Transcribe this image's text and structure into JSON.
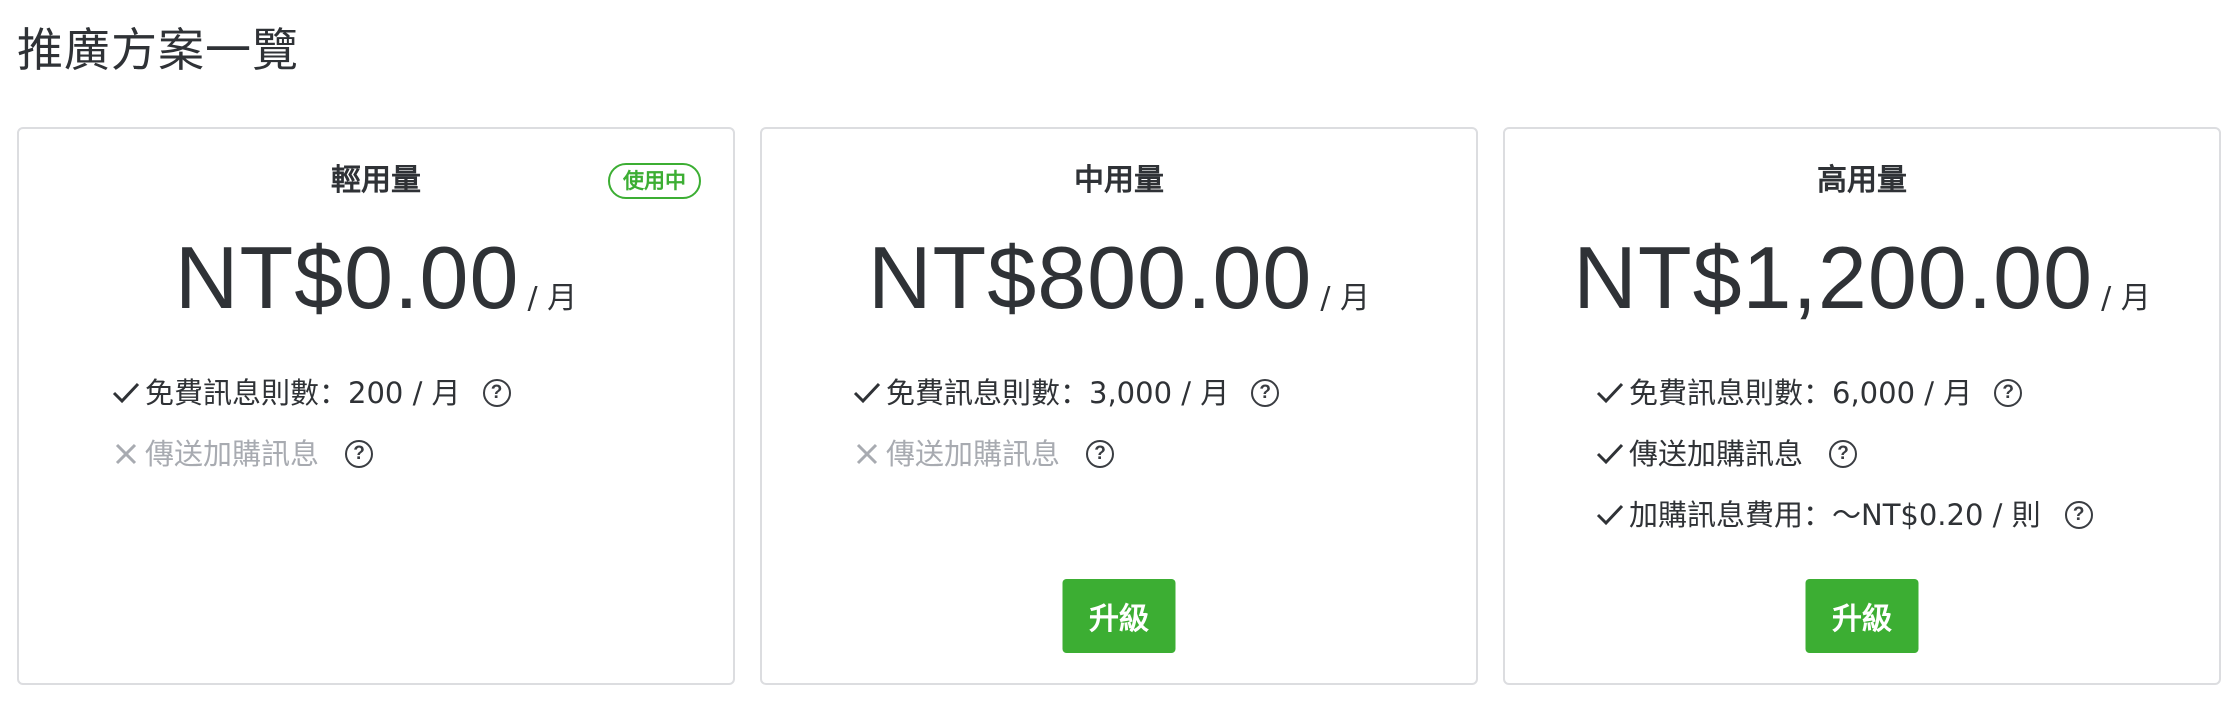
{
  "page": {
    "title": "推廣方案一覽"
  },
  "colors": {
    "accent_green": "#3cae33",
    "text_dark": "#2f3236",
    "text_disabled": "#a8abb1",
    "card_border": "#dcdde0"
  },
  "plans": [
    {
      "name": "輕用量",
      "badge": "使用中",
      "price": "NT$0.00",
      "period": "/ 月",
      "features": [
        {
          "icon": "check-icon",
          "enabled": true,
          "label": "免費訊息則數：200 / 月",
          "help_icon": "question-circle-icon",
          "help_glyph": "?"
        },
        {
          "icon": "cross-icon",
          "enabled": false,
          "label": "傳送加購訊息",
          "help_icon": "question-circle-icon",
          "help_glyph": "?"
        }
      ]
    },
    {
      "name": "中用量",
      "price": "NT$800.00",
      "period": "/ 月",
      "features": [
        {
          "icon": "check-icon",
          "enabled": true,
          "label": "免費訊息則數：3,000 / 月",
          "help_icon": "question-circle-icon",
          "help_glyph": "?"
        },
        {
          "icon": "cross-icon",
          "enabled": false,
          "label": "傳送加購訊息",
          "help_icon": "question-circle-icon",
          "help_glyph": "?"
        }
      ],
      "button_label": "升級"
    },
    {
      "name": "高用量",
      "price": "NT$1,200.00",
      "period": "/ 月",
      "features": [
        {
          "icon": "check-icon",
          "enabled": true,
          "label": "免費訊息則數：6,000 / 月",
          "help_icon": "question-circle-icon",
          "help_glyph": "?"
        },
        {
          "icon": "check-icon",
          "enabled": true,
          "label": "傳送加購訊息",
          "help_icon": "question-circle-icon",
          "help_glyph": "?"
        },
        {
          "icon": "check-icon",
          "enabled": true,
          "label": "加購訊息費用：～NT$0.20 / 則",
          "help_icon": "question-circle-icon",
          "help_glyph": "?"
        }
      ],
      "button_label": "升級"
    }
  ]
}
